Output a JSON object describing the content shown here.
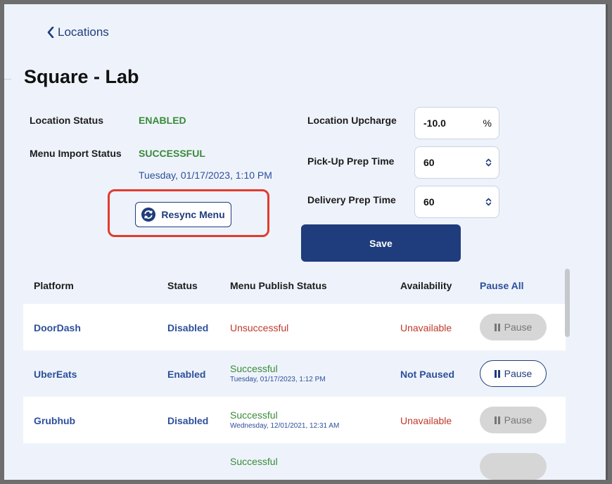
{
  "nav": {
    "back_label": "Locations"
  },
  "page": {
    "title": "Square - Lab"
  },
  "location_info": {
    "location_status_label": "Location Status",
    "location_status_value": "ENABLED",
    "menu_import_label": "Menu Import Status",
    "menu_import_value": "SUCCESSFUL",
    "menu_import_timestamp": "Tuesday, 01/17/2023, 1:10 PM",
    "resync_label": "Resync Menu"
  },
  "settings": {
    "upcharge_label": "Location Upcharge",
    "upcharge_value": "-10.0",
    "upcharge_unit": "%",
    "pickup_label": "Pick-Up Prep Time",
    "pickup_value": "60",
    "delivery_label": "Delivery Prep Time",
    "delivery_value": "60",
    "save_label": "Save"
  },
  "table": {
    "headers": {
      "platform": "Platform",
      "status": "Status",
      "menu_publish": "Menu Publish Status",
      "availability": "Availability",
      "pause_all": "Pause All"
    },
    "rows": [
      {
        "platform": "DoorDash",
        "status": "Disabled",
        "publish": "Unsuccessful",
        "publish_date": "",
        "availability": "Unavailable",
        "pause": "Pause"
      },
      {
        "platform": "UberEats",
        "status": "Enabled",
        "publish": "Successful",
        "publish_date": "Tuesday, 01/17/2023, 1:12 PM",
        "availability": "Not Paused",
        "pause": "Pause"
      },
      {
        "platform": "Grubhub",
        "status": "Disabled",
        "publish": "Successful",
        "publish_date": "Wednesday, 12/01/2021, 12:31 AM",
        "availability": "Unavailable",
        "pause": "Pause"
      },
      {
        "publish": "Successful"
      }
    ]
  },
  "colors": {
    "brand_navy": "#1f3c7c",
    "success_green": "#3a8a3a",
    "error_red": "#c0392b",
    "highlight_red": "#e23b2e"
  }
}
